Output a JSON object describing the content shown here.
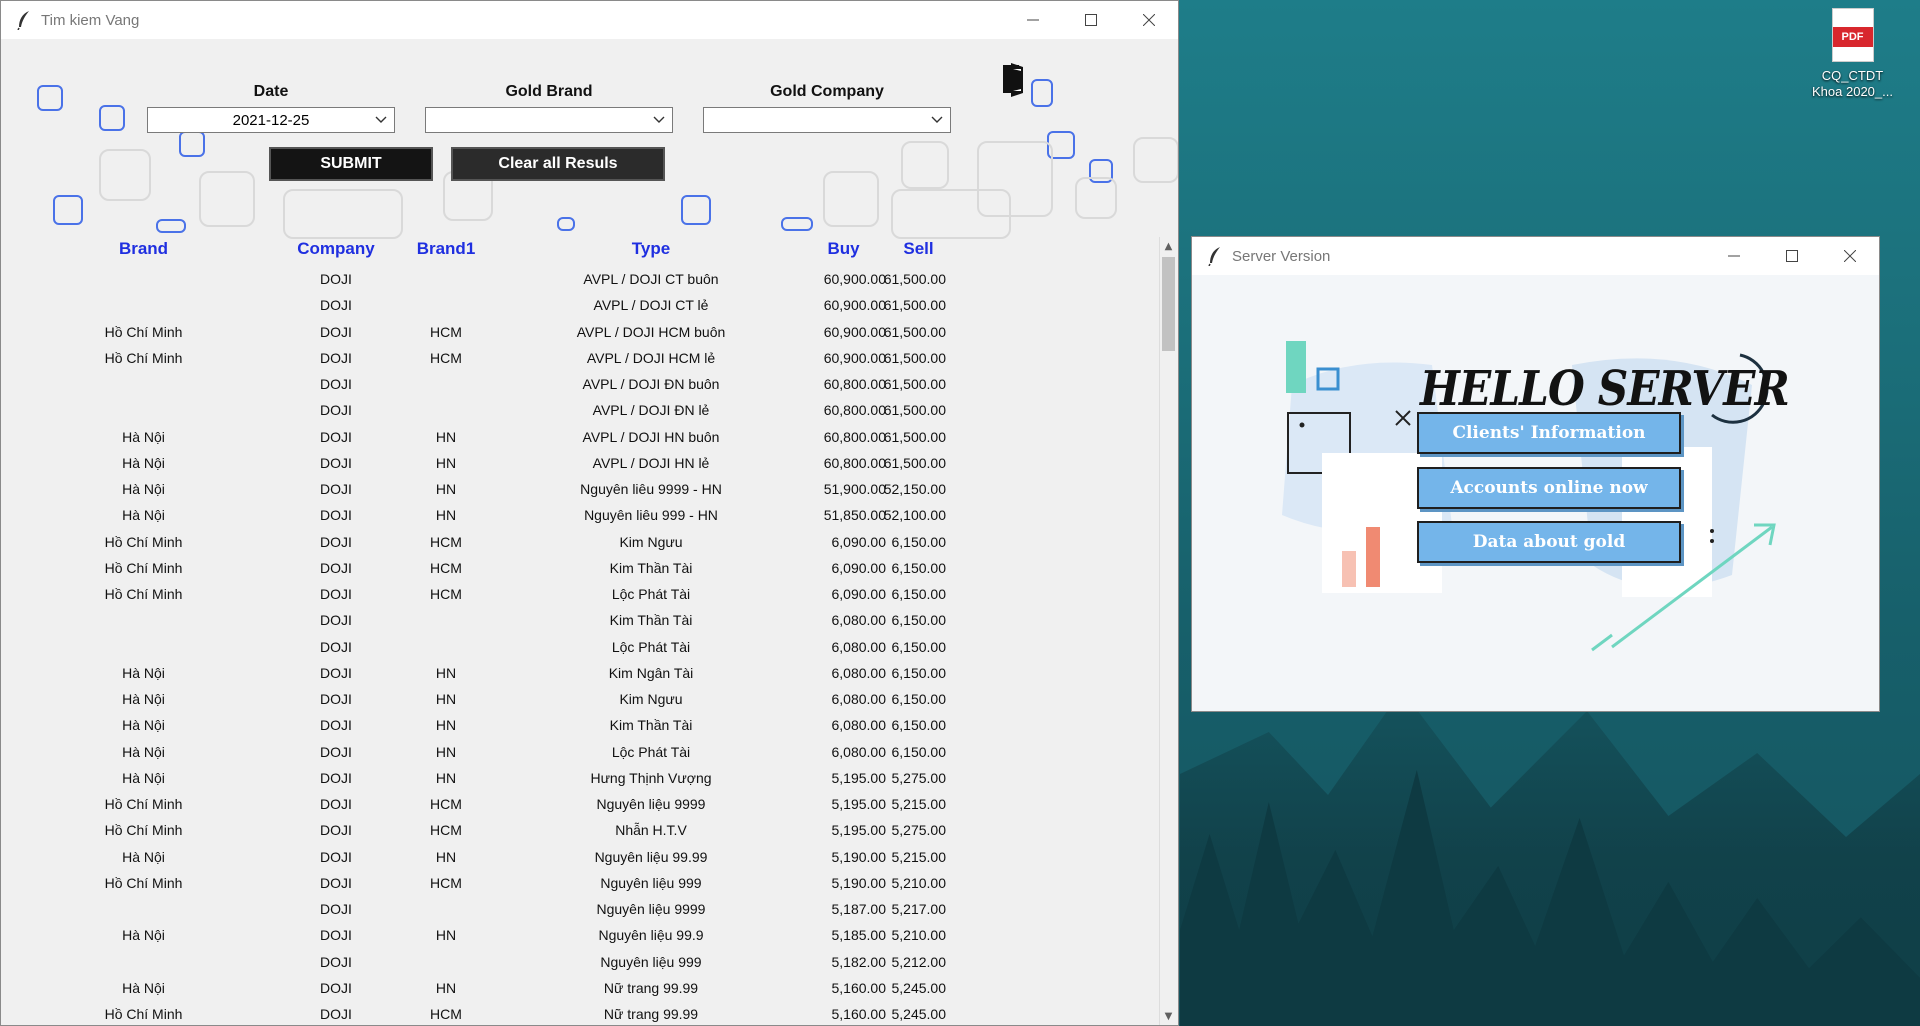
{
  "desktop": {
    "icon": {
      "name": "pdf-file-icon",
      "badge": "PDF",
      "label": "CQ_CTDT Khoa 2020_..."
    }
  },
  "main_window": {
    "title": "Tim kiem Vang",
    "date_label": "Date",
    "date_value": "2021-12-25",
    "brand_label": "Gold Brand",
    "brand_value": "",
    "company_label": "Gold Company",
    "company_value": "",
    "submit_label": "SUBMIT",
    "clear_label": "Clear all Resuls",
    "columns": [
      "Brand",
      "Company",
      "Brand1",
      "Type",
      "Buy",
      "Sell"
    ],
    "rows": [
      [
        "",
        "DOJI",
        "",
        "AVPL / DOJI CT buôn",
        "60,900.00",
        "61,500.00"
      ],
      [
        "",
        "DOJI",
        "",
        "AVPL / DOJI CT lẻ",
        "60,900.00",
        "61,500.00"
      ],
      [
        "Hồ Chí Minh",
        "DOJI",
        "HCM",
        "AVPL / DOJI HCM buôn",
        "60,900.00",
        "61,500.00"
      ],
      [
        "Hồ Chí Minh",
        "DOJI",
        "HCM",
        "AVPL / DOJI HCM lẻ",
        "60,900.00",
        "61,500.00"
      ],
      [
        "",
        "DOJI",
        "",
        "AVPL / DOJI ĐN buôn",
        "60,800.00",
        "61,500.00"
      ],
      [
        "",
        "DOJI",
        "",
        "AVPL / DOJI ĐN lẻ",
        "60,800.00",
        "61,500.00"
      ],
      [
        "Hà Nội",
        "DOJI",
        "HN",
        "AVPL / DOJI HN buôn",
        "60,800.00",
        "61,500.00"
      ],
      [
        "Hà Nội",
        "DOJI",
        "HN",
        "AVPL / DOJI HN lẻ",
        "60,800.00",
        "61,500.00"
      ],
      [
        "Hà Nội",
        "DOJI",
        "HN",
        "Nguyên liêu 9999 - HN",
        "51,900.00",
        "52,150.00"
      ],
      [
        "Hà Nội",
        "DOJI",
        "HN",
        "Nguyên liêu 999 - HN",
        "51,850.00",
        "52,100.00"
      ],
      [
        "Hồ Chí Minh",
        "DOJI",
        "HCM",
        "Kim Ngưu",
        "6,090.00",
        "6,150.00"
      ],
      [
        "Hồ Chí Minh",
        "DOJI",
        "HCM",
        "Kim Thần Tài",
        "6,090.00",
        "6,150.00"
      ],
      [
        "Hồ Chí Minh",
        "DOJI",
        "HCM",
        "Lộc Phát Tài",
        "6,090.00",
        "6,150.00"
      ],
      [
        "",
        "DOJI",
        "",
        "Kim Thần Tài",
        "6,080.00",
        "6,150.00"
      ],
      [
        "",
        "DOJI",
        "",
        "Lộc Phát Tài",
        "6,080.00",
        "6,150.00"
      ],
      [
        "Hà Nội",
        "DOJI",
        "HN",
        "Kim Ngân Tài",
        "6,080.00",
        "6,150.00"
      ],
      [
        "Hà Nội",
        "DOJI",
        "HN",
        "Kim Ngưu",
        "6,080.00",
        "6,150.00"
      ],
      [
        "Hà Nội",
        "DOJI",
        "HN",
        "Kim Thần Tài",
        "6,080.00",
        "6,150.00"
      ],
      [
        "Hà Nội",
        "DOJI",
        "HN",
        "Lộc Phát Tài",
        "6,080.00",
        "6,150.00"
      ],
      [
        "Hà Nội",
        "DOJI",
        "HN",
        "Hưng Thịnh Vượng",
        "5,195.00",
        "5,275.00"
      ],
      [
        "Hồ Chí Minh",
        "DOJI",
        "HCM",
        "Nguyên liệu 9999",
        "5,195.00",
        "5,215.00"
      ],
      [
        "Hồ Chí Minh",
        "DOJI",
        "HCM",
        "Nhẫn H.T.V",
        "5,195.00",
        "5,275.00"
      ],
      [
        "Hà Nội",
        "DOJI",
        "HN",
        "Nguyên liệu 99.99",
        "5,190.00",
        "5,215.00"
      ],
      [
        "Hồ Chí Minh",
        "DOJI",
        "HCM",
        "Nguyên liệu 999",
        "5,190.00",
        "5,210.00"
      ],
      [
        "",
        "DOJI",
        "",
        "Nguyên liệu 9999",
        "5,187.00",
        "5,217.00"
      ],
      [
        "Hà Nội",
        "DOJI",
        "HN",
        "Nguyên liệu 99.9",
        "5,185.00",
        "5,210.00"
      ],
      [
        "",
        "DOJI",
        "",
        "Nguyên liệu 999",
        "5,182.00",
        "5,212.00"
      ],
      [
        "Hà Nội",
        "DOJI",
        "HN",
        "Nữ trang 99.99",
        "5,160.00",
        "5,245.00"
      ],
      [
        "Hồ Chí Minh",
        "DOJI",
        "HCM",
        "Nữ trang 99.99",
        "5,160.00",
        "5,245.00"
      ]
    ]
  },
  "server_window": {
    "title": "Server Version",
    "heading": "HELLO SERVER",
    "buttons": [
      "Clients' Information",
      "Accounts online now",
      "Data about gold"
    ]
  },
  "colors": {
    "header_blue": "#1f2fe0",
    "button_blue": "#74b5ea",
    "deco_blue": "#4a72e8"
  }
}
